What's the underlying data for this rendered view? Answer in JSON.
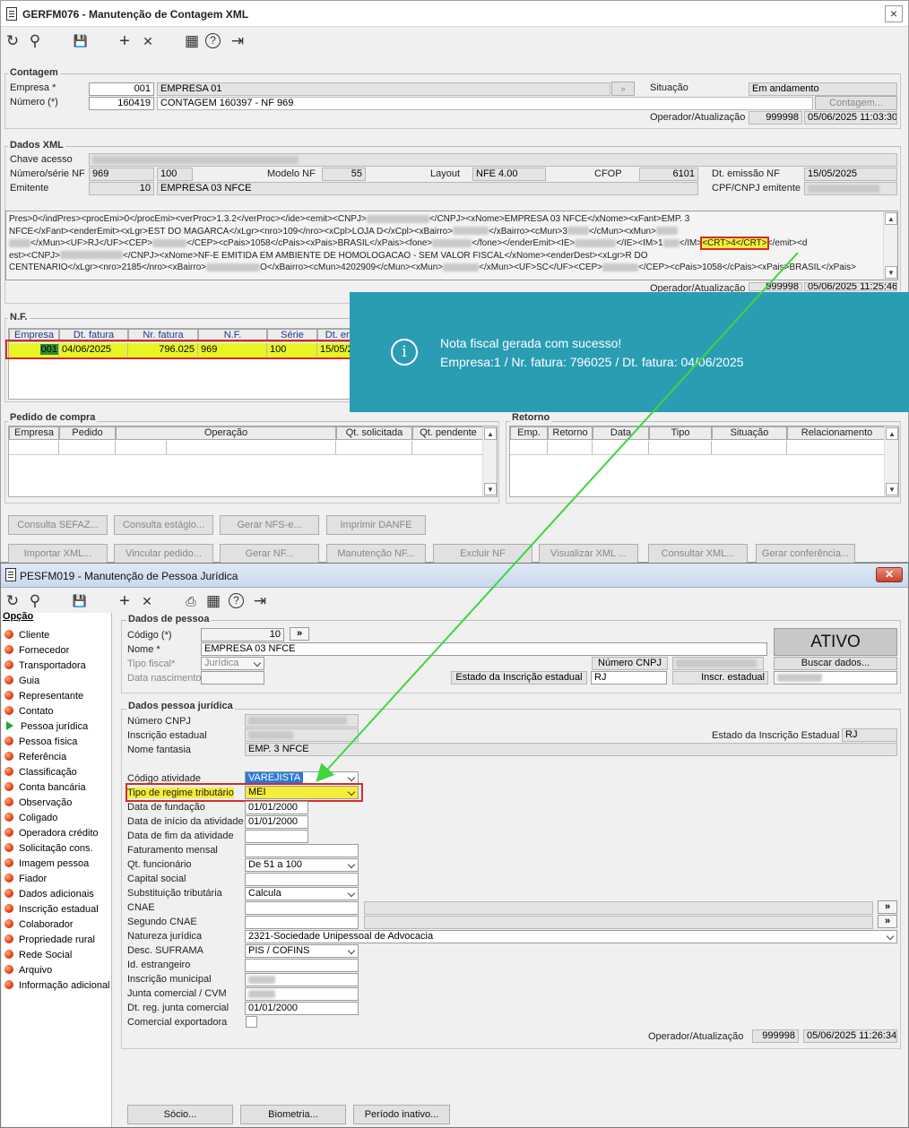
{
  "win1": {
    "title": "GERFM076 - Manutenção de Contagem XML",
    "close": "×",
    "toolbar": {
      "refresh_icon": "↻",
      "search_icon": "⚲",
      "save_icon": "💾",
      "add_icon": "+",
      "delete_icon": "✕",
      "calendar_icon": "▦",
      "help_icon": "?",
      "exit_icon": "⇥"
    },
    "contagem": {
      "group": "Contagem",
      "empresa_label": "Empresa *",
      "empresa_code": "001",
      "empresa_name": "EMPRESA 01",
      "numero_label": "Número (*)",
      "numero_code": "160419",
      "numero_desc": "CONTAGEM 160397 - NF 969",
      "situacao_label": "Situação",
      "situacao_value": "Em andamento",
      "contagem_btn": "Contagem...",
      "operador_label": "Operador/Atualização",
      "operador_value": "999998",
      "atualizacao_value": "05/06/2025 11:03:30"
    },
    "dados_xml": {
      "group": "Dados XML",
      "chave_label": "Chave acesso",
      "numserie_label": "Número/série NF",
      "numero_nf": "969",
      "serie_nf": "100",
      "modelo_label": "Modelo NF",
      "modelo_value": "55",
      "layout_label": "Layout",
      "layout_value": "NFE 4.00",
      "cfop_label": "CFOP",
      "cfop_value": "6101",
      "dtemissao_label": "Dt. emissão NF",
      "dtemissao_value": "15/05/2025",
      "emitente_label": "Emitente",
      "emitente_code": "10",
      "emitente_name": "EMPRESA 03 NFCE",
      "cpfcnpj_label": "CPF/CNPJ emitente",
      "xml_line1": "Pres>0</indPres><procEmi>0</procEmi><verProc>1.3.2</verProc></ide><emit><CNPJ>",
      "xml_line1b": "</CNPJ><xNome>EMPRESA 03 NFCE</xNome><xFant>EMP. 3",
      "xml_line2": "NFCE</xFant><enderEmit><xLgr>EST DO MAGARCA</xLgr><nro>109</nro><xCpl>LOJA D</xCpl><xBairro>",
      "xml_line2b": "</xBairro><cMun>3",
      "xml_line2c": "</cMun><xMun>",
      "xml_line3a": "</xMun><UF>RJ</UF><CEP>",
      "xml_line3b": "</CEP><cPais>1058</cPais><xPais>BRASIL</xPais><fone>",
      "xml_line3c": "</fone></enderEmit><IE>",
      "xml_line3d": "</IE><IM>1",
      "xml_line3e": "</IM>",
      "xml_crt": "<CRT>4</CRT>",
      "xml_line3f": "</emit><d",
      "xml_line4a": "est><CNPJ>",
      "xml_line4b": "</CNPJ><xNome>NF-E EMITIDA EM AMBIENTE DE HOMOLOGACAO - SEM VALOR FISCAL</xNome><enderDest><xLgr>R DO",
      "xml_line5a": "CENTENARIO</xLgr><nro>2185</nro><xBairro>",
      "xml_line5b": "O</xBairro><cMun>4202909</cMun><xMun>",
      "xml_line5c": "</xMun><UF>SC</UF><CEP>",
      "xml_line5d": "</CEP><cPais>1058</cPais><xPais>BRASIL</xPais>",
      "operador_label": "Operador/Atualização",
      "operador_value": "999998",
      "atualizacao_value": "05/06/2025 11:25:46"
    },
    "nf": {
      "group": "N.F.",
      "headers": [
        "Empresa",
        "Dt. fatura",
        "Nr. fatura",
        "N.F.",
        "Série",
        "Dt. em"
      ],
      "row": [
        "001",
        "04/06/2025",
        "796.025",
        "969",
        "100",
        "15/05/2"
      ]
    },
    "pedido": {
      "group": "Pedido de compra",
      "headers": [
        "Empresa",
        "Pedido",
        "Operação",
        "Qt. solicitada",
        "Qt. pendente"
      ]
    },
    "retorno": {
      "group": "Retorno",
      "headers": [
        "Emp.",
        "Retorno",
        "Data",
        "Tipo",
        "Situação",
        "Relacionamento"
      ]
    },
    "buttons_row1": [
      "Consulta SEFAZ...",
      "Consulta estágio...",
      "Gerar NFS-e...",
      "Imprimir DANFE"
    ],
    "buttons_row2": [
      "Importar XML...",
      "Vincular pedido...",
      "Gerar NF...",
      "Manutenção NF...",
      "Excluir NF",
      "Visualizar XML ...",
      "Consultar XML...",
      "Gerar conferência..."
    ]
  },
  "toast": {
    "icon": "i",
    "line1": "Nota fiscal gerada com sucesso!",
    "line2": "Empresa:1 / Nr. fatura: 796025 / Dt. fatura: 04/06/2025"
  },
  "win2": {
    "title": "PESFM019 - Manutenção de Pessoa Jurídica",
    "close": "✕",
    "sidebar_header": "Opção",
    "sidebar_items": [
      "Cliente",
      "Fornecedor",
      "Transportadora",
      "Guia",
      "Representante",
      "Contato",
      "Pessoa jurídica",
      "Pessoa física",
      "Referência",
      "Classificação",
      "Conta bancária",
      "Observação",
      "Coligado",
      "Operadora crédito",
      "Solicitação cons.",
      "Imagem pessoa",
      "Fiador",
      "Dados adicionais",
      "Inscrição estadual",
      "Colaborador",
      "Propriedade rural",
      "Rede Social",
      "Arquivo",
      "Informação adicional"
    ],
    "sidebar_active": "Pessoa jurídica",
    "dados_pessoa": {
      "group": "Dados de pessoa",
      "codigo_label": "Código (*)",
      "codigo_value": "10",
      "nome_label": "Nome *",
      "nome_value": "EMPRESA 03 NFCE",
      "tipo_fiscal_label": "Tipo fiscal*",
      "tipo_fiscal_value": "Jurídica",
      "data_nasc_label": "Data nascimento",
      "status": "ATIVO",
      "numero_cnpj_label": "Número CNPJ",
      "buscar_btn": "Buscar dados...",
      "estado_ie_label": "Estado da Inscrição estadual",
      "estado_ie_value": "RJ",
      "inscr_estadual_label": "Inscr. estadual",
      "dbl": "»"
    },
    "dados_pj": {
      "group": "Dados pessoa jurídica",
      "numero_cnpj_label": "Número CNPJ",
      "inscricao_label": "Inscrição estadual",
      "estado_ie_label": "Estado da Inscrição Estadual",
      "estado_ie_value": "RJ",
      "fantasia_label": "Nome fantasia",
      "fantasia_value": "EMP. 3 NFCE",
      "codigo_atividade_label": "Código atividade",
      "codigo_atividade_value": "VAREJISTA",
      "regime_label": "Tipo de regime tributário",
      "regime_value": "MEI",
      "fundacao_label": "Data de fundação",
      "fundacao_value": "01/01/2000",
      "inicio_label": "Data de início da atividade",
      "inicio_value": "01/01/2000",
      "fim_label": "Data de fim da atividade",
      "faturamento_label": "Faturamento mensal",
      "qt_func_label": "Qt. funcionário",
      "qt_func_value": "De 51 a 100",
      "capital_label": "Capital social",
      "subst_label": "Substituição tributária",
      "subst_value": "Calcula",
      "cnae_label": "CNAE",
      "segundo_cnae_label": "Segundo CNAE",
      "natureza_label": "Natureza jurídica",
      "natureza_value": "2321-Sociedade Unipessoal de Advocacia",
      "suframa_label": "Desc. SUFRAMA",
      "suframa_value": "PIS / COFINS",
      "id_estrangeiro_label": "Id. estrangeiro",
      "insc_municipal_label": "Inscrição municipal",
      "junta_label": "Junta comercial / CVM",
      "dt_junta_label": "Dt. reg. junta comercial",
      "dt_junta_value": "01/01/2000",
      "exportadora_label": "Comercial exportadora",
      "operador_label": "Operador/Atualização",
      "operador_value": "999998",
      "atualizacao_value": "05/06/2025 11:26:34"
    },
    "buttons": [
      "Sócio...",
      "Biometria...",
      "Período inativo..."
    ]
  }
}
